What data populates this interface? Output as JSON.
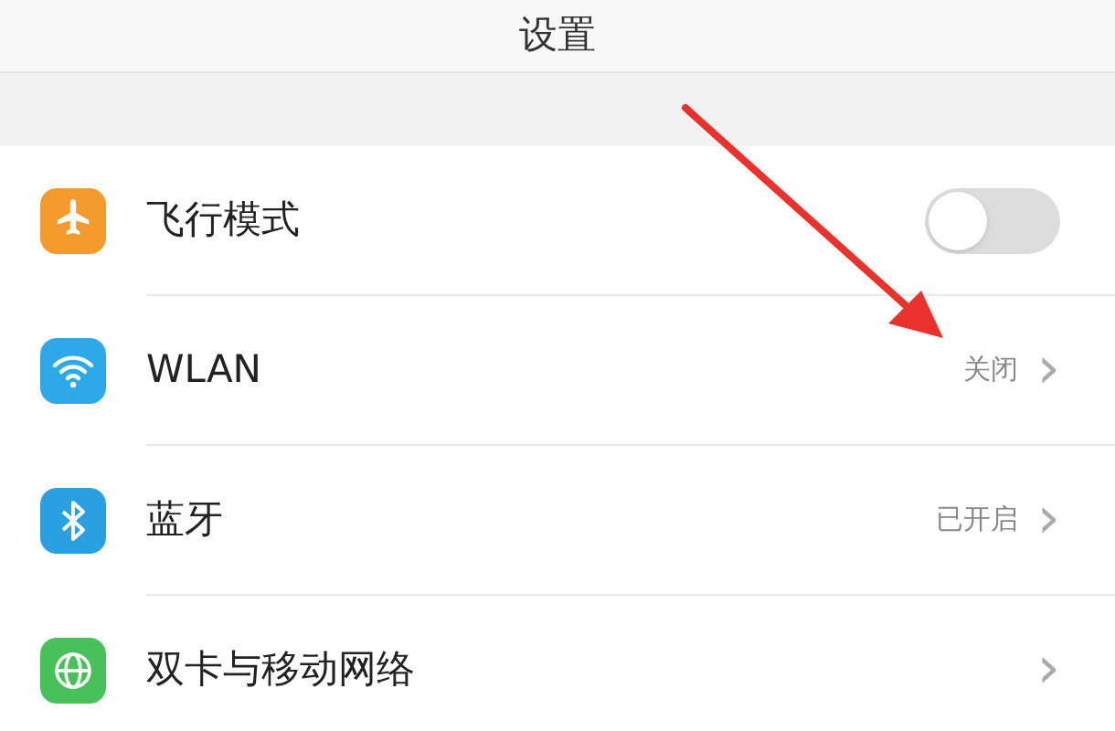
{
  "title": "设置",
  "rows": [
    {
      "kind": "toggle",
      "label": "飞行模式",
      "on": false
    },
    {
      "kind": "detail",
      "label": "WLAN",
      "value": "关闭",
      "chevron": "›"
    },
    {
      "kind": "detail",
      "label": "蓝牙",
      "value": "已开启",
      "chevron": "›"
    },
    {
      "kind": "detail",
      "label": "双卡与移动网络",
      "chevron": "›"
    }
  ]
}
